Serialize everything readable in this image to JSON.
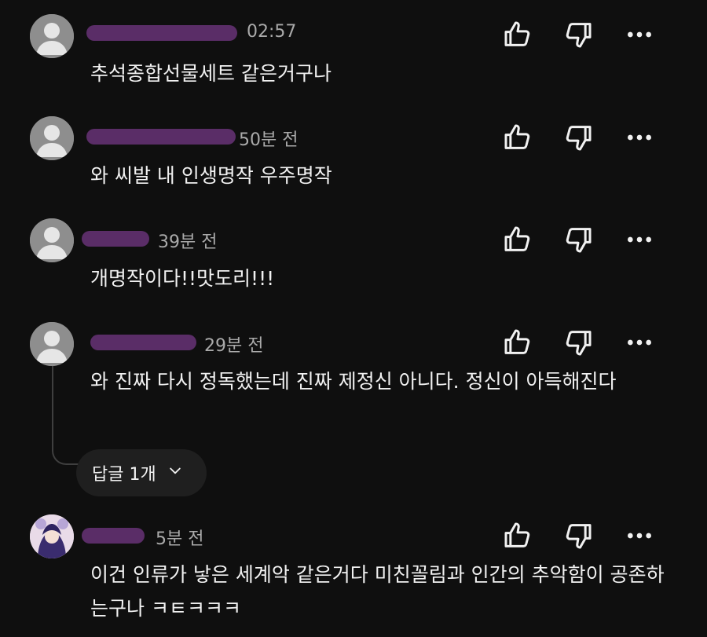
{
  "comments": [
    {
      "time": "02:57",
      "text": "추석종합선물세트 같은거구나"
    },
    {
      "time": "50분 전",
      "text": "와 씨발 내 인생명작 우주명작"
    },
    {
      "time": "39분 전",
      "text": "개명작이다!!맛도리!!!"
    },
    {
      "time": "29분 전",
      "text": "와 진짜 다시 정독했는데 진짜 제정신 아니다. 정신이 아득해진다"
    },
    {
      "time": "5분 전",
      "text": "이건 인류가 낳은 세계악 같은거다 미친꼴림과 인간의 추악함이 공존하는구나 ㅋㅌㅋㅋㅋ"
    }
  ],
  "reply_button": {
    "label": "답글 1개"
  },
  "icons": {
    "like": "thumbs-up-icon",
    "dislike": "thumbs-down-icon",
    "more": "more-options-icon",
    "expand": "chevron-down-icon"
  },
  "colors": {
    "background": "#0f0f0f",
    "text": "#f1f1f1",
    "muted": "#aaaaaa",
    "redaction": "#5a2d67"
  }
}
